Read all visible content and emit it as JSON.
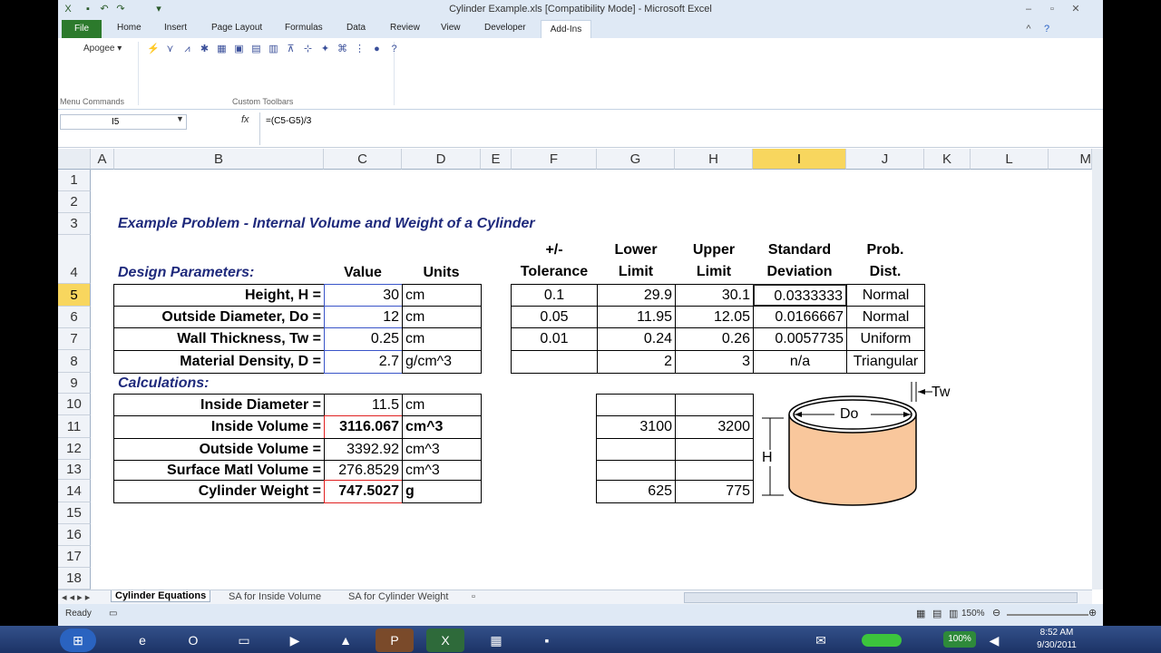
{
  "window": {
    "title": "Cylinder Example.xls  [Compatibility Mode]  -  Microsoft Excel"
  },
  "ribbon": {
    "tabs": [
      "File",
      "Home",
      "Insert",
      "Page Layout",
      "Formulas",
      "Data",
      "Review",
      "View",
      "Developer",
      "Add-Ins"
    ],
    "apogee": "Apogee ▾",
    "group1": "Menu Commands",
    "group2": "Custom Toolbars"
  },
  "formula_bar": {
    "name_box": "I5",
    "fx": "fx",
    "formula": "=(C5-G5)/3"
  },
  "columns": [
    "A",
    "B",
    "C",
    "D",
    "E",
    "F",
    "G",
    "H",
    "I",
    "J",
    "K",
    "L",
    "M"
  ],
  "rows": [
    "1",
    "2",
    "3",
    "4",
    "5",
    "6",
    "7",
    "8",
    "9",
    "10",
    "11",
    "12",
    "13",
    "14",
    "15",
    "16",
    "17",
    "18"
  ],
  "sheet": {
    "title": "Example Problem - Internal Volume and Weight of a Cylinder",
    "design_header": "Design Parameters:",
    "value_header": "Value",
    "units_header": "Units",
    "tol_header": [
      "+/-",
      "Tolerance"
    ],
    "lower_header": [
      "Lower",
      "Limit"
    ],
    "upper_header": [
      "Upper",
      "Limit"
    ],
    "std_header": [
      "Standard",
      "Deviation"
    ],
    "dist_header": [
      "Prob.",
      "Dist."
    ],
    "params": [
      {
        "label": "Height, H =",
        "value": "30",
        "unit": "cm",
        "tol": "0.1",
        "lower": "29.9",
        "upper": "30.1",
        "std": "0.0333333",
        "dist": "Normal"
      },
      {
        "label": "Outside Diameter, Do =",
        "value": "12",
        "unit": "cm",
        "tol": "0.05",
        "lower": "11.95",
        "upper": "12.05",
        "std": "0.0166667",
        "dist": "Normal"
      },
      {
        "label": "Wall Thickness, Tw =",
        "value": "0.25",
        "unit": "cm",
        "tol": "0.01",
        "lower": "0.24",
        "upper": "0.26",
        "std": "0.0057735",
        "dist": "Uniform"
      },
      {
        "label": "Material Density, D =",
        "value": "2.7",
        "unit": "g/cm^3",
        "tol": "",
        "lower": "2",
        "upper": "3",
        "std": "n/a",
        "dist": "Triangular"
      }
    ],
    "calc_header": "Calculations:",
    "calcs": [
      {
        "label": "Inside Diameter =",
        "value": "11.5",
        "unit": "cm",
        "lower": "",
        "upper": ""
      },
      {
        "label": "Inside Volume =",
        "value": "3116.067",
        "unit": "cm^3",
        "lower": "3100",
        "upper": "3200"
      },
      {
        "label": "Outside Volume =",
        "value": "3392.92",
        "unit": "cm^3",
        "lower": "",
        "upper": ""
      },
      {
        "label": "Surface Matl Volume =",
        "value": "276.8529",
        "unit": "cm^3",
        "lower": "",
        "upper": ""
      },
      {
        "label": "Cylinder Weight =",
        "value": "747.5027",
        "unit": "g",
        "lower": "625",
        "upper": "775"
      }
    ],
    "diagram": {
      "do": "Do",
      "h": "H",
      "tw": "Tw"
    }
  },
  "sheet_tabs": [
    "Cylinder Equations",
    "SA for Inside Volume",
    "SA for Cylinder Weight"
  ],
  "status": {
    "ready": "Ready",
    "zoom": "150%"
  },
  "taskbar": {
    "battery": "100%",
    "time": "8:52 AM",
    "date": "9/30/2011"
  }
}
